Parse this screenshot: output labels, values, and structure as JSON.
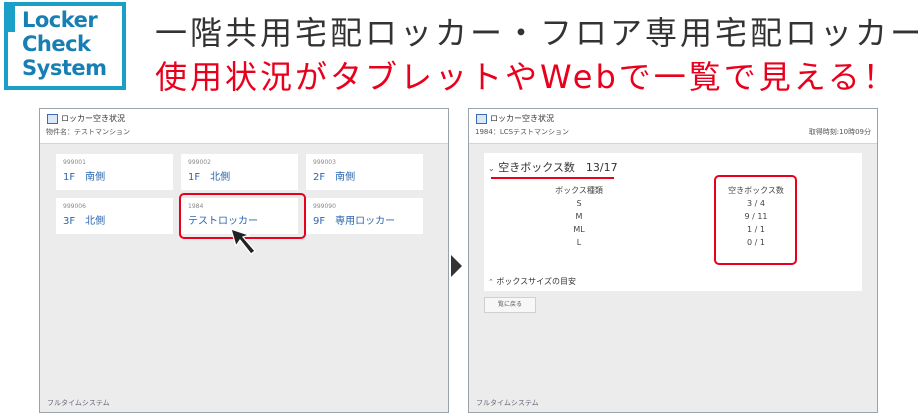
{
  "logo": {
    "line1": "Locker",
    "line2": "Check",
    "line3": "System"
  },
  "headline": {
    "line1": "一階共用宅配ロッカー・フロア専用宅配ロッカーの",
    "line2": "使用状況がタブレットやWebで一覧で見える！"
  },
  "screen1": {
    "title": "ロッカー空き状況",
    "subtitle": "物件名：テストマンション",
    "cards": [
      {
        "id": "999001",
        "name": "1F　南側"
      },
      {
        "id": "999002",
        "name": "1F　北側"
      },
      {
        "id": "999003",
        "name": "2F　南側"
      },
      {
        "id": "999006",
        "name": "3F　北側"
      },
      {
        "id": "1984",
        "name": "テストロッカー"
      },
      {
        "id": "999090",
        "name": "9F　専用ロッカー"
      }
    ],
    "footer": "フルタイムシステム"
  },
  "screen2": {
    "title": "ロッカー空き状況",
    "subtitle": "1984：LCSテストマンション",
    "fetched": "取得時刻:10時09分",
    "section_title": "空きボックス数　13/17",
    "col_type_header": "ボックス種類",
    "col_free_header": "空きボックス数",
    "rows": [
      {
        "type": "S",
        "free": "3 / 4"
      },
      {
        "type": "M",
        "free": "9 / 11"
      },
      {
        "type": "ML",
        "free": "1 / 1"
      },
      {
        "type": "L",
        "free": "0 / 1"
      }
    ],
    "size_guide": "ボックスサイズの目安",
    "back_button": "覧に戻る",
    "footer": "フルタイムシステム"
  },
  "colors": {
    "accent_red": "#e8001c",
    "link_blue": "#2a66b0",
    "logo_blue": "#177fb3"
  }
}
